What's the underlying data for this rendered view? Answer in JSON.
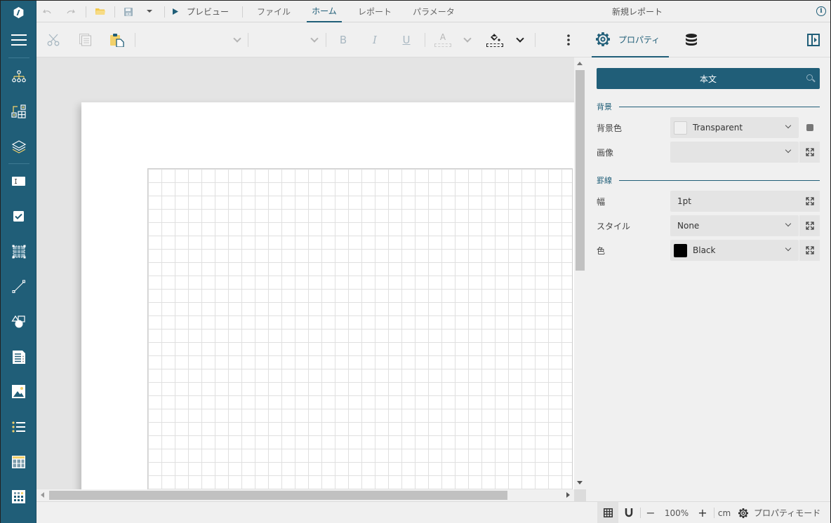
{
  "app": {
    "document_title": "新規レポート"
  },
  "topbar": {
    "undo_icon": "undo-icon",
    "redo_icon": "redo-icon",
    "open_icon": "folder-open-icon",
    "save_icon": "save-icon",
    "preview_label": "プレビュー",
    "tabs": [
      {
        "label": "ファイル",
        "active": false
      },
      {
        "label": "ホーム",
        "active": true
      },
      {
        "label": "レポート",
        "active": false
      },
      {
        "label": "パラメータ",
        "active": false
      }
    ],
    "info_icon_glyph": "i"
  },
  "toolbar": {
    "cut_icon": "scissors-icon",
    "copy_icon": "copy-icon",
    "paste_icon": "paste-icon",
    "font_family_value": "",
    "font_size_value": "",
    "bold_label": "B",
    "italic_label": "I",
    "underline_label": "U",
    "font_color_label": "A",
    "properties_tab_label": "プロパティ"
  },
  "sidebar": {
    "items": [
      {
        "name": "menu",
        "icon": "hamburger-icon"
      },
      {
        "name": "report-explorer",
        "icon": "tree-icon"
      },
      {
        "name": "components",
        "icon": "components-icon"
      },
      {
        "name": "layers",
        "icon": "layers-icon"
      },
      {
        "name": "textbox",
        "icon": "textbox-icon"
      },
      {
        "name": "checkbox",
        "icon": "checkbox-icon"
      },
      {
        "name": "container",
        "icon": "container-icon"
      },
      {
        "name": "line",
        "icon": "line-icon"
      },
      {
        "name": "shape",
        "icon": "shape-icon"
      },
      {
        "name": "richtext",
        "icon": "richtext-icon"
      },
      {
        "name": "image",
        "icon": "image-icon"
      },
      {
        "name": "list",
        "icon": "list-icon"
      },
      {
        "name": "table",
        "icon": "table-icon"
      },
      {
        "name": "tablix",
        "icon": "tablix-icon"
      }
    ]
  },
  "panel": {
    "search_label": "本文",
    "sections": {
      "background": "背景",
      "border": "罫線"
    },
    "rows": {
      "bg_color": {
        "label": "背景色",
        "value": "Transparent",
        "swatch": "#f0f0f0"
      },
      "image": {
        "label": "画像",
        "value": ""
      },
      "width": {
        "label": "幅",
        "value": "1pt"
      },
      "style": {
        "label": "スタイル",
        "value": "None"
      },
      "color": {
        "label": "色",
        "value": "Black",
        "swatch": "#000000"
      }
    }
  },
  "statusbar": {
    "zoom_out": "−",
    "zoom_level": "100%",
    "zoom_in": "+",
    "units": "cm",
    "property_mode_label": "プロパティモード"
  },
  "colors": {
    "accent": "#205e78",
    "sidebar_highlight": "#f2d16b"
  }
}
